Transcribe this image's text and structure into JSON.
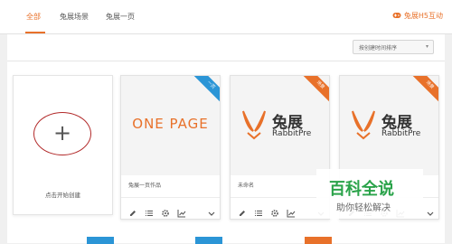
{
  "nav": {
    "tabs": [
      {
        "label": "全部"
      },
      {
        "label": "兔展场景"
      },
      {
        "label": "兔展一页"
      }
    ],
    "brand": "兔展H5互动"
  },
  "toolbar": {
    "sort_value": "按创建时间排序"
  },
  "create_card": {
    "plus": "+",
    "label": "点击开始创建"
  },
  "cards": [
    {
      "ribbon": "一页",
      "title": "兔展一页作品",
      "thumb_text": "ONE PAGE"
    },
    {
      "ribbon": "场景",
      "title": "未命名",
      "logo_cn": "兔展",
      "logo_en": "RabbitPre"
    },
    {
      "ribbon": "场景",
      "title": "",
      "logo_cn": "兔展",
      "logo_en": "RabbitPre"
    }
  ],
  "watermark": {
    "main": "百科全说",
    "sub": "助你轻松解决"
  },
  "colors": {
    "accent": "#e8712a",
    "ribbon_blue": "#2b95d6",
    "watermark_green": "#2aa34a"
  }
}
